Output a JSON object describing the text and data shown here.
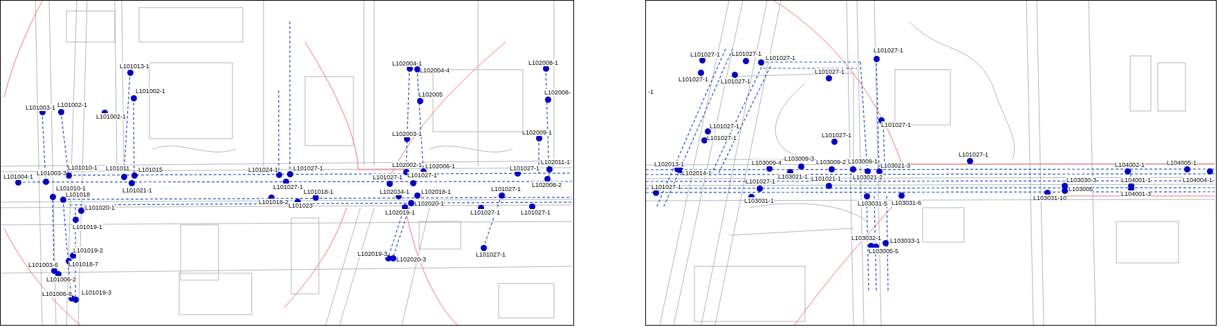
{
  "panels": [
    {
      "points": [
        {
          "label": "L101013-1"
        },
        {
          "label": "L101002-1"
        },
        {
          "label": "L101003-1"
        },
        {
          "label": "L101002-1"
        },
        {
          "label": "L101002-1"
        },
        {
          "label": "L101010-1"
        },
        {
          "label": "L101011"
        },
        {
          "label": "L101015"
        },
        {
          "label": "L101024-1"
        },
        {
          "label": "L101004-1"
        },
        {
          "label": "L101003-3"
        },
        {
          "label": "L101010-1"
        },
        {
          "label": "L101021-1"
        },
        {
          "label": "L101018"
        },
        {
          "label": "L101018-2"
        },
        {
          "label": "L101020-1"
        },
        {
          "label": "L101019-1"
        },
        {
          "label": "L101019-2"
        },
        {
          "label": "L101018-7"
        },
        {
          "label": "L101003-6"
        },
        {
          "label": "L101006-2"
        },
        {
          "label": "L101006-8"
        },
        {
          "label": "L101019-3"
        },
        {
          "label": "L102004-1"
        },
        {
          "label": "L102004-4"
        },
        {
          "label": "L102005"
        },
        {
          "label": "L102008-1"
        },
        {
          "label": "L102008-"
        },
        {
          "label": "L102003-1"
        },
        {
          "label": "L102009-1"
        },
        {
          "label": "L101027-1"
        },
        {
          "label": "L102002-1"
        },
        {
          "label": "L102006-1"
        },
        {
          "label": "L101027-1"
        },
        {
          "label": "L102011-1"
        },
        {
          "label": "L101027-1"
        },
        {
          "label": "L101027-1"
        },
        {
          "label": "L101027-1"
        },
        {
          "label": "L102008-2"
        },
        {
          "label": "L101018-1"
        },
        {
          "label": "L101023"
        },
        {
          "label": "L102034-1"
        },
        {
          "label": "L102018-1"
        },
        {
          "label": "L101027-1"
        },
        {
          "label": "L102020-1"
        },
        {
          "label": "L102019-1"
        },
        {
          "label": "L101027-1"
        },
        {
          "label": "L101027-1"
        },
        {
          "label": "L101027-1"
        },
        {
          "label": "L102019-3"
        },
        {
          "label": "L102020-3"
        }
      ]
    },
    {
      "points": [
        {
          "label": "-1"
        },
        {
          "label": "L101027-1"
        },
        {
          "label": "L101027-1"
        },
        {
          "label": "L101027-1"
        },
        {
          "label": "L101027-1"
        },
        {
          "label": "L101027-1"
        },
        {
          "label": "L101027-1"
        },
        {
          "label": "L101027-1"
        },
        {
          "label": "L101027-1"
        },
        {
          "label": "L101027-1"
        },
        {
          "label": "L101027-1"
        },
        {
          "label": "L101027-1"
        },
        {
          "label": "L102013-1"
        },
        {
          "label": "L102014-1"
        },
        {
          "label": "L103009-4"
        },
        {
          "label": "L103009-3"
        },
        {
          "label": "L103009-2"
        },
        {
          "label": "L103009-1"
        },
        {
          "label": "L103021-3"
        },
        {
          "label": "L103021-1"
        },
        {
          "label": "L101021-1"
        },
        {
          "label": "L103021-2"
        },
        {
          "label": "L101027-1"
        },
        {
          "label": "L101027-1"
        },
        {
          "label": "L103031-1"
        },
        {
          "label": "L103031-5"
        },
        {
          "label": "L103031-6"
        },
        {
          "label": "L103032-1"
        },
        {
          "label": "L103005-5"
        },
        {
          "label": "L103033-1"
        },
        {
          "label": "L101027-1"
        },
        {
          "label": "L104002-1"
        },
        {
          "label": "L104005-1"
        },
        {
          "label": "L103030-3"
        },
        {
          "label": "L104001-1"
        },
        {
          "label": "L104004-1"
        },
        {
          "label": "L103005"
        },
        {
          "label": "L104001-3"
        },
        {
          "label": "L103031-10"
        }
      ]
    }
  ]
}
